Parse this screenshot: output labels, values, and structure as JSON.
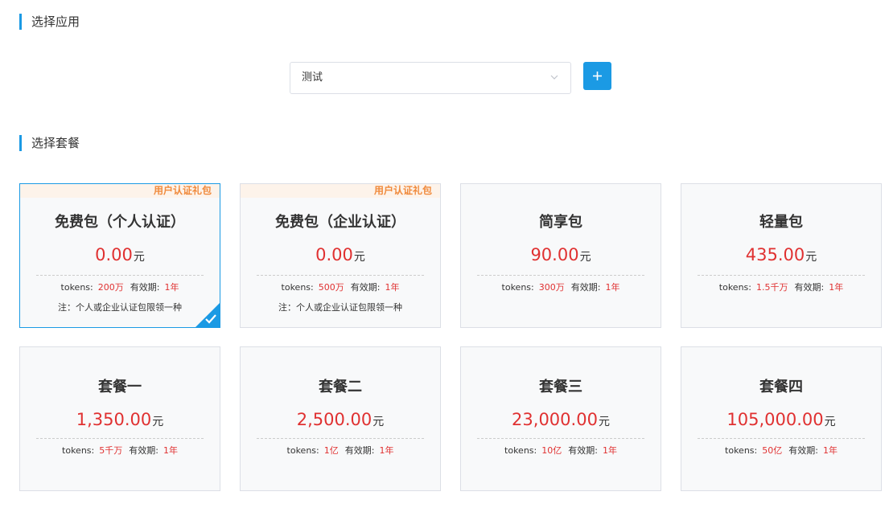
{
  "sections": {
    "app_title": "选择应用",
    "package_title": "选择套餐"
  },
  "app_select": {
    "value": "测试",
    "chevron_icon": "chevron-down-icon"
  },
  "add_button": {
    "icon": "plus-icon",
    "color": "#1b9ae4"
  },
  "colors": {
    "accent": "#1b9ae4",
    "price": "#e03131",
    "ribbon_text": "#f08a3c",
    "ribbon_bg": "#fdf3ea"
  },
  "labels": {
    "tokens": "tokens:",
    "validity": "有效期:",
    "unit": "元"
  },
  "packages": [
    {
      "ribbon": "用户认证礼包",
      "name": "免费包（个人认证）",
      "price": "0.00",
      "tokens": "200万",
      "validity": "1年",
      "note": "注：个人或企业认证包限领一种",
      "selected": true
    },
    {
      "ribbon": "用户认证礼包",
      "name": "免费包（企业认证）",
      "price": "0.00",
      "tokens": "500万",
      "validity": "1年",
      "note": "注：个人或企业认证包限领一种",
      "selected": false
    },
    {
      "name": "简享包",
      "price": "90.00",
      "tokens": "300万",
      "validity": "1年",
      "selected": false
    },
    {
      "name": "轻量包",
      "price": "435.00",
      "tokens": "1.5千万",
      "validity": "1年",
      "selected": false
    },
    {
      "name": "套餐一",
      "price": "1,350.00",
      "tokens": "5千万",
      "validity": "1年",
      "selected": false
    },
    {
      "name": "套餐二",
      "price": "2,500.00",
      "tokens": "1亿",
      "validity": "1年",
      "selected": false
    },
    {
      "name": "套餐三",
      "price": "23,000.00",
      "tokens": "10亿",
      "validity": "1年",
      "selected": false
    },
    {
      "name": "套餐四",
      "price": "105,000.00",
      "tokens": "50亿",
      "validity": "1年",
      "selected": false
    }
  ]
}
